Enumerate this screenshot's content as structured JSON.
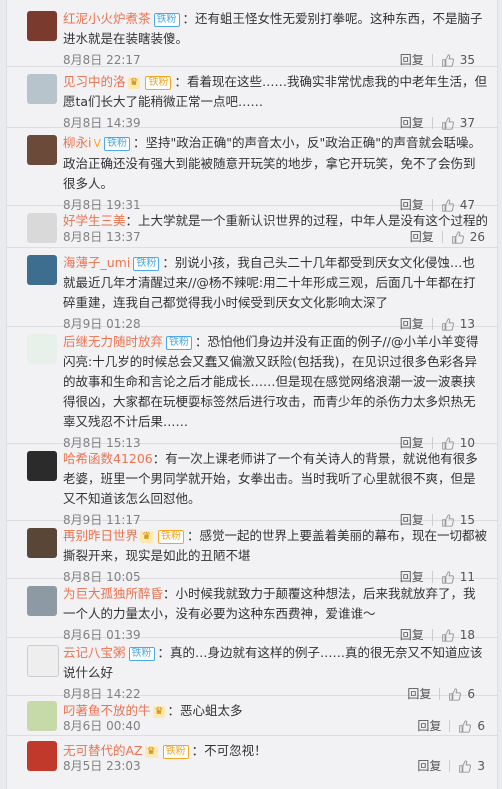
{
  "labels": {
    "reply": "回复"
  },
  "comments": [
    {
      "user": "红泥小火炉煮茶",
      "badge": "铁粉",
      "body": "：还有蛆王怪女性无爱别打拳呢。这种东西，不是脑子进水就是在装瞎装傻。",
      "time": "8月8日 22:17",
      "likes": "35",
      "avatar_color": "#7a3b2e"
    },
    {
      "user": "见习中的洛",
      "badge": "铁粉",
      "body": "：看着现在这些……我确实非常忧虑我的中老年生活，但愿ta们长大了能稍微正常一点吧……",
      "time": "8月8日 14:39",
      "likes": "37",
      "avatar_color": "#b8c4cc"
    },
    {
      "user": "柳永i",
      "badge": "铁粉",
      "body": "：坚持\"政治正确\"的声音太小，反\"政治正确\"的声音就会聒噪。政治正确还没有强大到能被随意开玩笑的地步，拿它开玩笑，免不了会伤到很多人。",
      "time": "8月8日 19:31",
      "likes": "47",
      "avatar_color": "#6b4a3a"
    },
    {
      "user": "好学生三美",
      "badge": "",
      "body": "：上大学就是一个重新认识世界的过程，中年人是没有这个过程的",
      "time": "8月8日 13:37",
      "likes": "26",
      "avatar_color": "#d9d9d9"
    },
    {
      "user": "海薄子_umi",
      "badge": "铁粉",
      "body": "：别说小孩，我自己头二十几年都受到厌女文化侵蚀…也就最近几年才清醒过来//@杨不辣呢:用二十年形成三观，后面几十年都在打碎重建，连我自己都觉得我小时候受到厌女文化影响太深了",
      "time": "8月9日 01:28",
      "likes": "13",
      "avatar_color": "#3d6e8f"
    },
    {
      "user": "后继无力随时放弃",
      "badge": "铁粉",
      "body": "：恐怕他们身边并没有正面的例子//@小羊小羊变得闪亮:十几岁的时候总会又蠢又偏激又跃险(包括我)，在见识过很多色彩各异的故事和生命和言论之后才能成长……但是现在感觉网络浪潮一波一波裹挟得很凶，大家都在玩梗耍标签然后进行攻击，而青少年的杀伤力太多炽热无辜又残忍不计后果……",
      "time": "8月8日 15:13",
      "likes": "10",
      "avatar_color": "#e8f0ea"
    },
    {
      "user": "哈希函数41206",
      "badge": "",
      "body": "：有一次上课老师讲了一个有关诗人的背景，就说他有很多老婆，班里一个男同学就开始，女拳出击。当时我听了心里就很不爽，但是又不知道该怎么回怼他。",
      "time": "8月9日 11:17",
      "likes": "15",
      "avatar_color": "#2b2b2b"
    },
    {
      "user": "再别昨日世界",
      "badge": "铁粉",
      "body": "：感觉一起的世界上要盖着美丽的幕布，现在一切都被撕裂开来，现实是如此的丑陋不堪",
      "time": "8月8日 10:05",
      "likes": "11",
      "avatar_color": "#5a4636"
    },
    {
      "user": "为巨大孤独所醉昏",
      "badge": "",
      "body": "：小时候我就致力于颠覆这种想法，后来我就放弃了，我一个人的力量太小，没有必要为这种东西费神，爱谁谁～",
      "time": "8月6日 01:39",
      "likes": "18",
      "avatar_color": "#8d9aa3"
    },
    {
      "user": "云记八宝粥",
      "badge": "铁粉",
      "body": "：真的…身边就有这样的例子……真的很无奈又不知道应该说什么好",
      "time": "8月8日 14:22",
      "likes": "6",
      "avatar_color": "#eeeeee"
    },
    {
      "user": "叼著鱼不放的牛",
      "badge": "",
      "body": "：恶心蛆太多",
      "time": "8月6日 00:40",
      "likes": "6",
      "avatar_color": "#c6d9a8"
    },
    {
      "user": "无可替代的AZ",
      "badge": "铁粉",
      "body": "：不可忽视！",
      "time": "8月5日 23:03",
      "likes": "3",
      "avatar_color": "#c0392b"
    }
  ]
}
